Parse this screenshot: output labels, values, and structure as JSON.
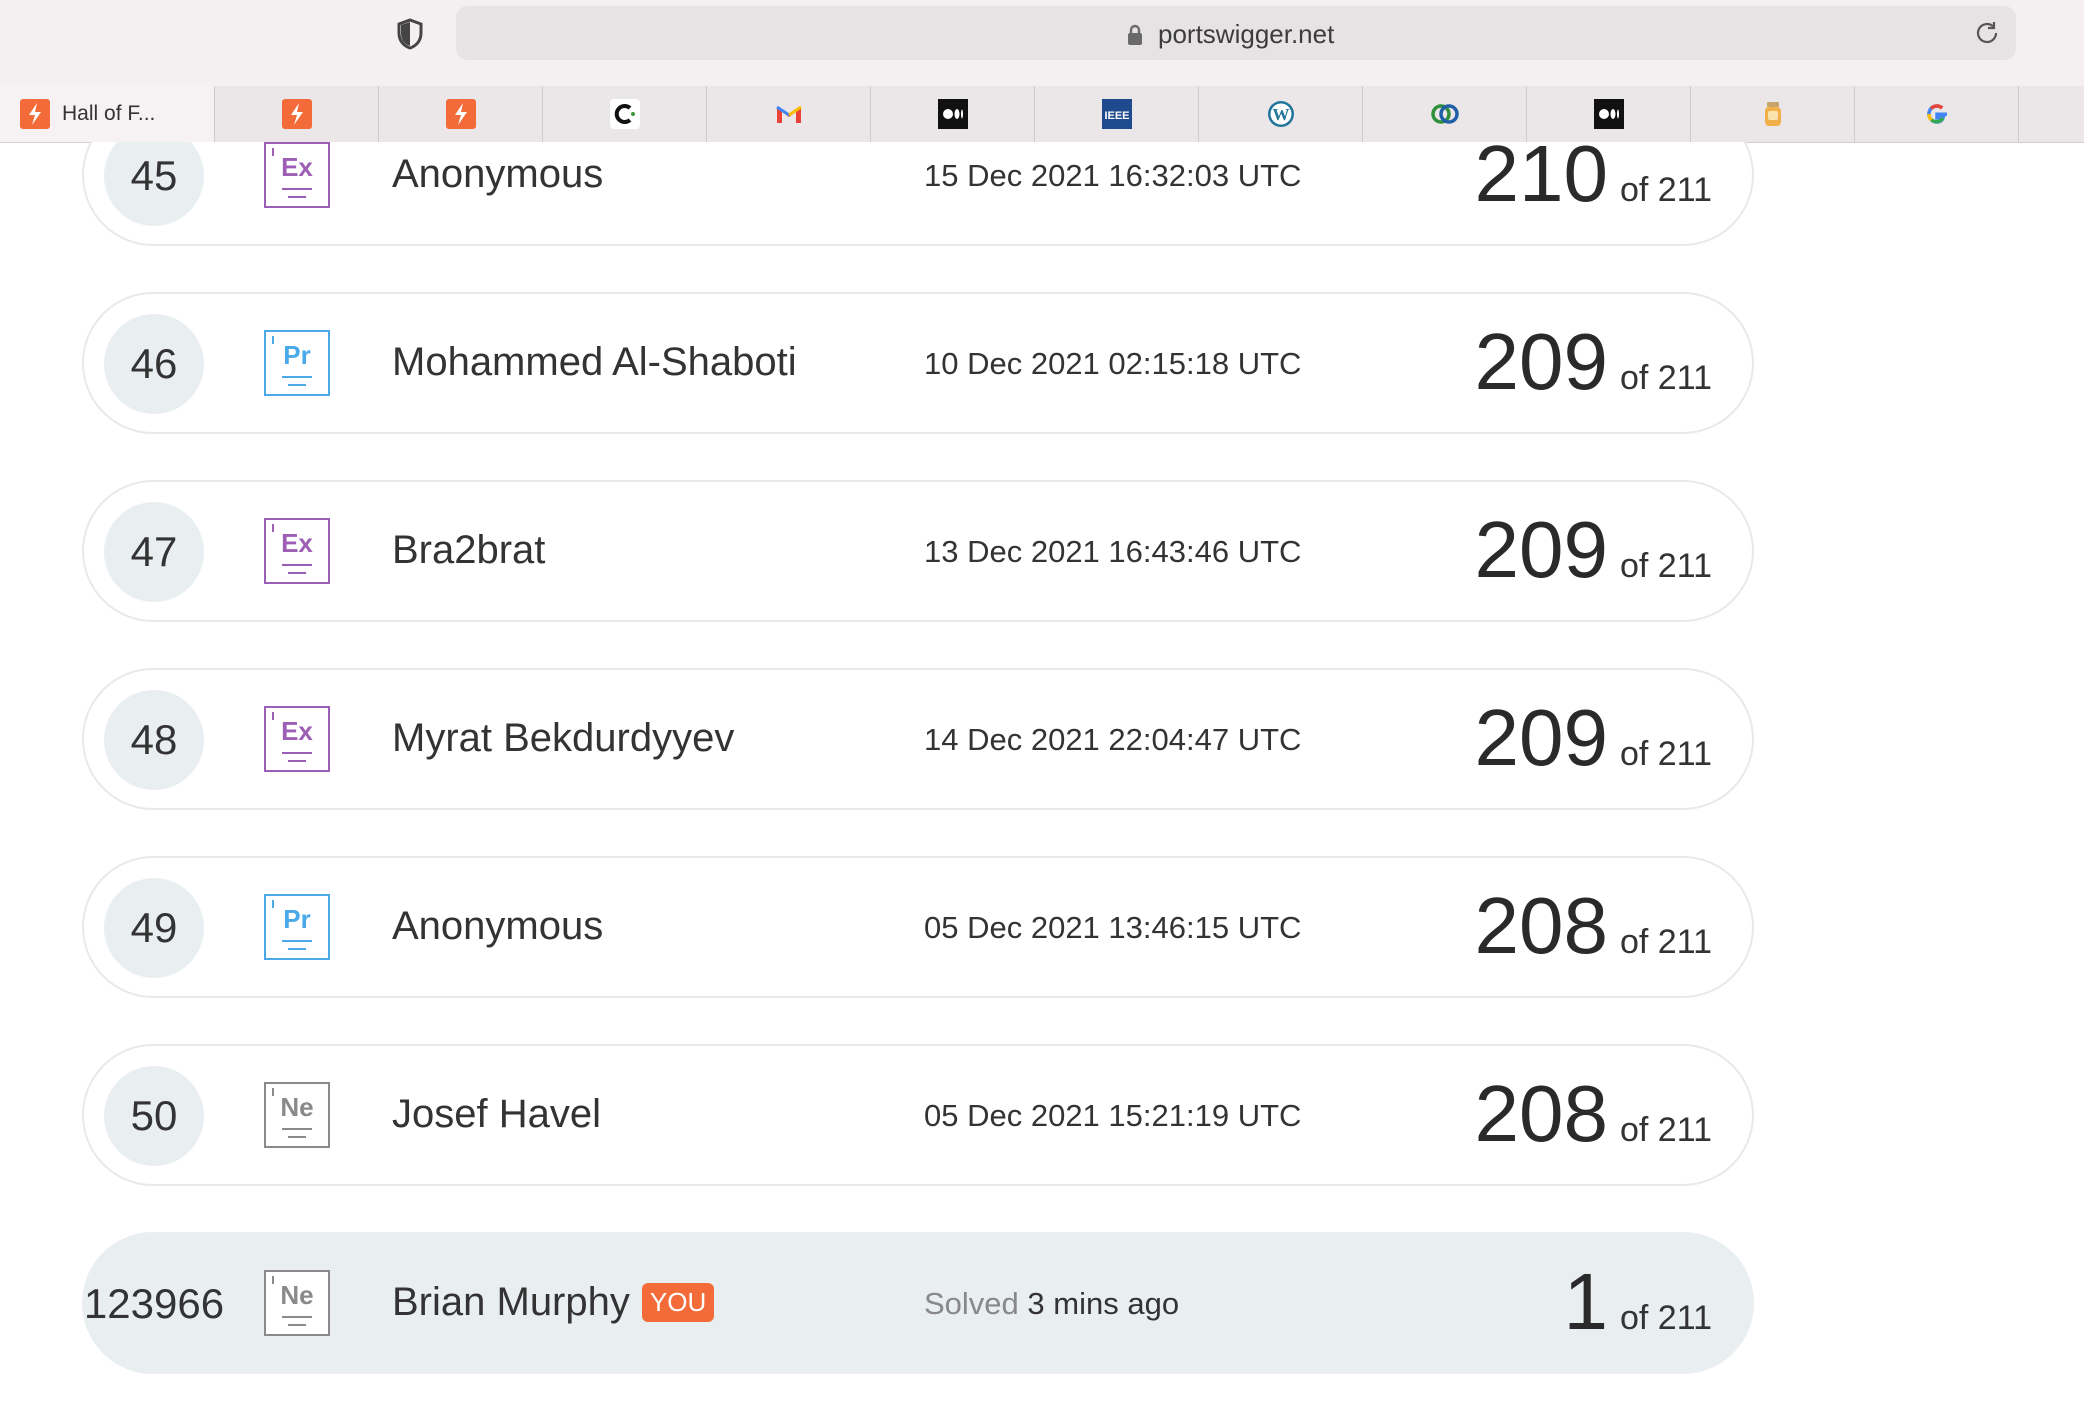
{
  "browser": {
    "url": "portswigger.net",
    "active_tab_title": "Hall of F...",
    "bookmarks": [
      "portswigger-icon",
      "portswigger-icon",
      "c-icon",
      "gmail-icon",
      "medium-icon",
      "ieee-icon",
      "wordpress-icon",
      "rings-icon",
      "medium-icon",
      "jar-icon",
      "google-icon"
    ]
  },
  "leaderboard": {
    "rows": [
      {
        "rank": "45",
        "level": "Ex",
        "level_kind": "ex",
        "name": "Anonymous",
        "date": "15 Dec 2021 16:32:03 UTC",
        "solved": "210",
        "total": "of 211"
      },
      {
        "rank": "46",
        "level": "Pr",
        "level_kind": "pr",
        "name": "Mohammed Al-Shaboti",
        "date": "10 Dec 2021 02:15:18 UTC",
        "solved": "209",
        "total": "of 211"
      },
      {
        "rank": "47",
        "level": "Ex",
        "level_kind": "ex",
        "name": "Bra2brat",
        "date": "13 Dec 2021 16:43:46 UTC",
        "solved": "209",
        "total": "of 211"
      },
      {
        "rank": "48",
        "level": "Ex",
        "level_kind": "ex",
        "name": "Myrat Bekdurdyyev",
        "date": "14 Dec 2021 22:04:47 UTC",
        "solved": "209",
        "total": "of 211"
      },
      {
        "rank": "49",
        "level": "Pr",
        "level_kind": "pr",
        "name": "Anonymous",
        "date": "05 Dec 2021 13:46:15 UTC",
        "solved": "208",
        "total": "of 211"
      },
      {
        "rank": "50",
        "level": "Ne",
        "level_kind": "ne",
        "name": "Josef Havel",
        "date": "05 Dec 2021 15:21:19 UTC",
        "solved": "208",
        "total": "of 211"
      }
    ],
    "you": {
      "rank": "123966",
      "level": "Ne",
      "level_kind": "ne",
      "name": "Brian Murphy",
      "tag": "YOU",
      "solved_label": "Solved",
      "solved_ago": "3 mins ago",
      "solved": "1",
      "total": "of 211"
    }
  },
  "colors": {
    "accent": "#f26b38",
    "expert": "#9c5fb5",
    "practitioner": "#4aa9e8",
    "newcomer": "#8a8a8a"
  }
}
